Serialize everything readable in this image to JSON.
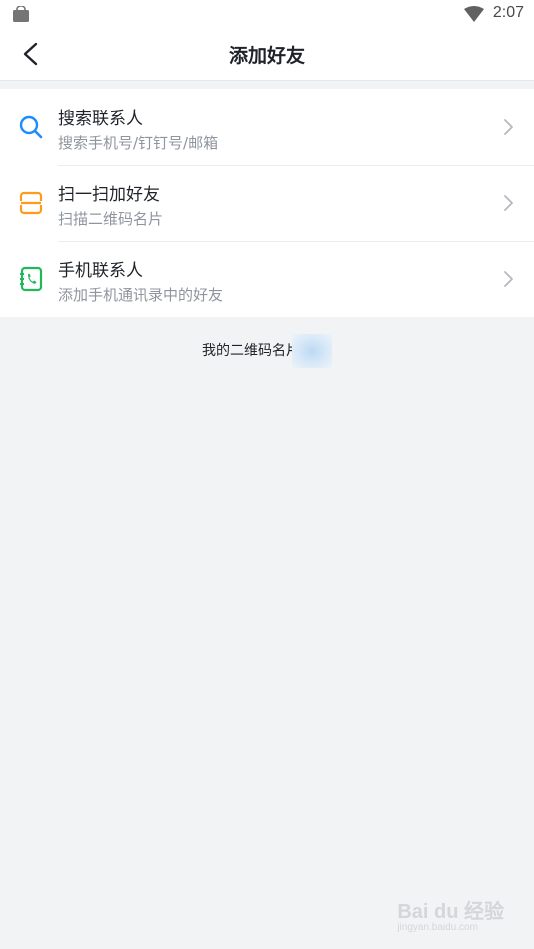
{
  "status_bar": {
    "time": "2:07",
    "icons": [
      "bag-icon",
      "wifi-icon"
    ]
  },
  "nav": {
    "title": "添加好友",
    "back_icon": "back-arrow-icon"
  },
  "items": [
    {
      "label": "搜索联系人",
      "subtitle": "搜索手机号/钉钉号/邮箱",
      "icon": "search-icon",
      "color": "#1a8cff"
    },
    {
      "label": "扫一扫加好友",
      "subtitle": "扫描二维码名片",
      "icon": "scan-icon",
      "color": "#ff9a1a"
    },
    {
      "label": "手机联系人",
      "subtitle": "添加手机通讯录中的好友",
      "icon": "phone-contacts-icon",
      "color": "#1fb85a"
    }
  ],
  "qr_link": {
    "label": "我的二维码名片"
  },
  "watermark": {
    "brand": "Bai du 经验",
    "url": "jingyan.baidu.com"
  }
}
